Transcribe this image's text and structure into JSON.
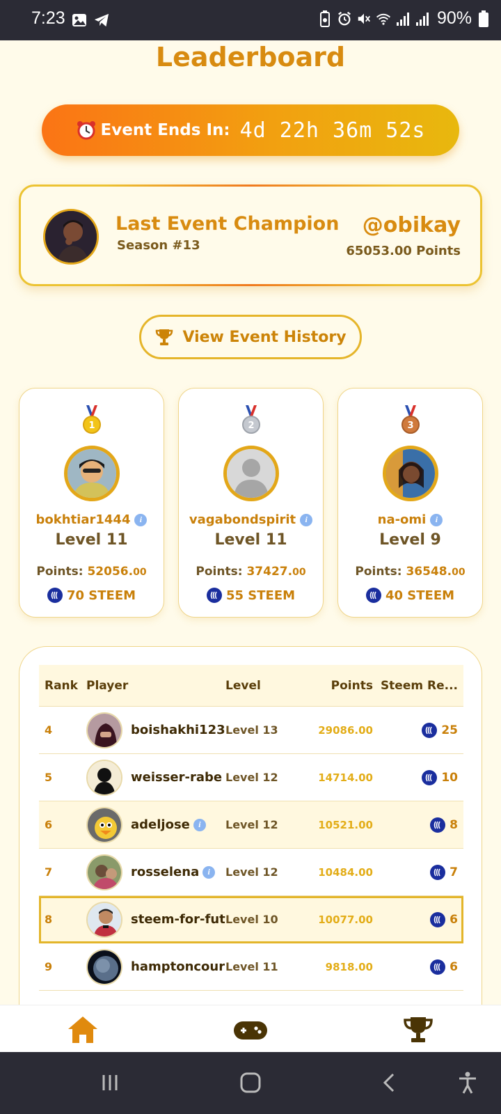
{
  "status_bar": {
    "time": "7:23",
    "battery": "90%",
    "icons": [
      "gallery-icon",
      "telegram-icon",
      "battery-saver-icon",
      "alarm-icon",
      "mute-icon",
      "wifi-icon",
      "signal-icon",
      "signal-icon",
      "battery-icon"
    ]
  },
  "title": "Leaderboard",
  "countdown": {
    "label": "Event Ends In:",
    "time": "4d 22h 36m 52s"
  },
  "champion": {
    "title": "Last Event Champion",
    "season": "Season #13",
    "handle": "@obikay",
    "points": "65053.00 Points"
  },
  "history_button": {
    "label": "View Event History"
  },
  "podium": [
    {
      "name": "bokhtiar1444",
      "level": "Level 11",
      "points_label": "Points:",
      "points": "52056.",
      "decimals": "00",
      "reward": "70 STEEM",
      "medal_color": "#f2c418",
      "rank": "1"
    },
    {
      "name": "vagabondspirit",
      "level": "Level 11",
      "points_label": "Points:",
      "points": "37427.",
      "decimals": "00",
      "reward": "55 STEEM",
      "medal_color": "#c4c8cf",
      "rank": "2"
    },
    {
      "name": "na-omi",
      "level": "Level 9",
      "points_label": "Points:",
      "points": "36548.",
      "decimals": "00",
      "reward": "40 STEEM",
      "medal_color": "#d07a3c",
      "rank": "3"
    }
  ],
  "table": {
    "headers": {
      "rank": "Rank",
      "player": "Player",
      "level": "Level",
      "points": "Points",
      "steem": "Steem Re..."
    },
    "rows": [
      {
        "rank": "4",
        "player": "boishakhi123",
        "level": "Level 13",
        "points": "29086.00",
        "steem": "25",
        "avatar_color": "#7a3a46"
      },
      {
        "rank": "5",
        "player": "weisser-rabe",
        "level": "Level 12",
        "points": "14714.00",
        "steem": "10",
        "avatar_color": "#111111"
      },
      {
        "rank": "6",
        "player": "adeljose",
        "level": "Level 12",
        "points": "10521.00",
        "steem": "8",
        "avatar_color": "#f3c935"
      },
      {
        "rank": "7",
        "player": "rosselena",
        "level": "Level 12",
        "points": "10484.00",
        "steem": "7",
        "avatar_color": "#6a4e3a"
      },
      {
        "rank": "8",
        "player": "steem-for-fut",
        "level": "Level 10",
        "points": "10077.00",
        "steem": "6",
        "avatar_color": "#c03040"
      },
      {
        "rank": "9",
        "player": "hamptoncour",
        "level": "Level 11",
        "points": "9818.00",
        "steem": "6",
        "avatar_color": "#2a3950"
      }
    ]
  },
  "colors": {
    "accent": "#d88b10",
    "steem_blue": "#1a2e9e",
    "gold_border": "#e3a719"
  }
}
